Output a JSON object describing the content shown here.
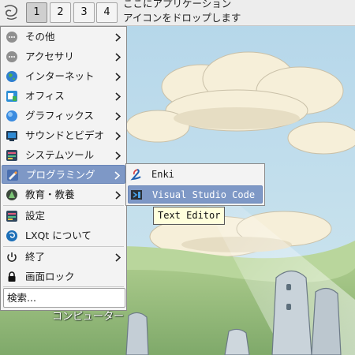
{
  "panel": {
    "workspaces": [
      "1",
      "2",
      "3",
      "4"
    ],
    "active_workspace": "1",
    "drop_hint_line1": "ここにアプリケーション",
    "drop_hint_line2": "アイコンをドロップします"
  },
  "menu": {
    "items": [
      {
        "label": "その他",
        "icon": "other-icon",
        "submenu": true
      },
      {
        "label": "アクセサリ",
        "icon": "accessories-icon",
        "submenu": true
      },
      {
        "label": "インターネット",
        "icon": "internet-globe-icon",
        "submenu": true
      },
      {
        "label": "オフィス",
        "icon": "office-icon",
        "submenu": true
      },
      {
        "label": "グラフィックス",
        "icon": "graphics-icon",
        "submenu": true
      },
      {
        "label": "サウンドとビデオ",
        "icon": "multimedia-icon",
        "submenu": true
      },
      {
        "label": "システムツール",
        "icon": "system-tools-icon",
        "submenu": true
      },
      {
        "label": "プログラミング",
        "icon": "programming-icon",
        "submenu": true,
        "highlighted": true
      },
      {
        "label": "教育・教養",
        "icon": "education-icon",
        "submenu": true
      },
      {
        "label": "設定",
        "icon": "settings-icon",
        "submenu": false
      },
      {
        "label": "LXQt について",
        "icon": "lxqt-logo-icon",
        "submenu": false
      },
      {
        "label": "終了",
        "icon": "power-icon",
        "submenu": true
      },
      {
        "label": "画面ロック",
        "icon": "lock-icon",
        "submenu": false
      }
    ],
    "search_text": "検索..."
  },
  "submenu": {
    "items": [
      {
        "label": "Enki",
        "icon": "enki-icon"
      },
      {
        "label": "Visual Studio Code",
        "icon": "vscode-icon",
        "highlighted": true
      }
    ]
  },
  "tooltip": {
    "text": "Text Editor"
  },
  "desktop": {
    "icon_label": "コンピューター"
  },
  "colors": {
    "highlight": "#7e98c6",
    "menu_bg": "#f3f3f3",
    "panel_bg": "#ededed",
    "sky": "#a9cfe6",
    "tooltip_bg": "#ffffdc"
  }
}
